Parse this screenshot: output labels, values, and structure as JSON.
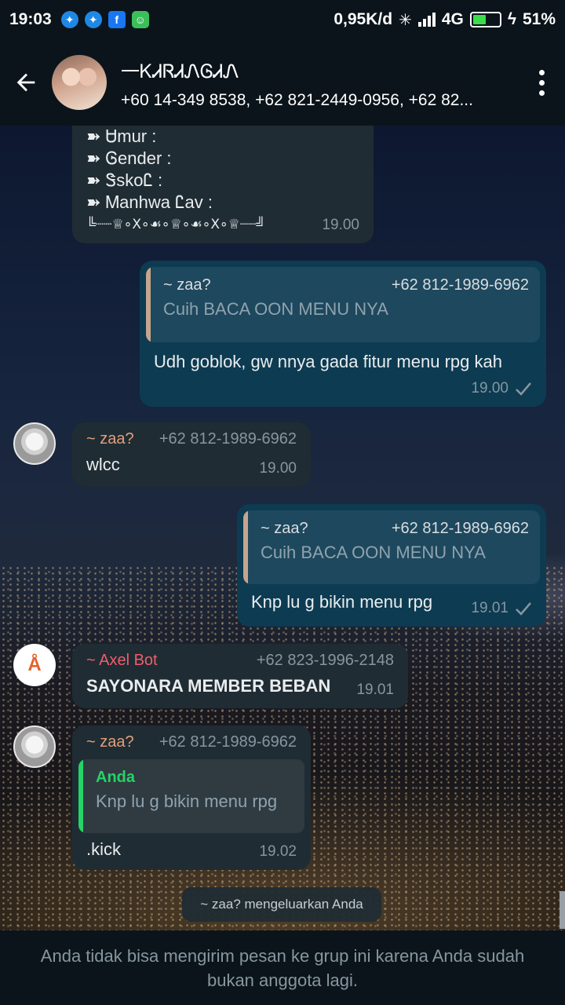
{
  "status_bar": {
    "time": "19:03",
    "net_speed": "0,95K/d",
    "network": "4G",
    "battery": "51%",
    "battery_level": 0.51,
    "notification_icons": [
      "messenger-icon",
      "messenger-icon",
      "facebook-icon",
      "android-icon"
    ]
  },
  "header": {
    "group_name": "一ᏦᏗᏒᏗᏁᎶᏗᏁ",
    "members": "+60 14-349 8538, +62 821-2449-0956, +62 82..."
  },
  "messages": {
    "m1": {
      "lines": [
        "➽ Ꮜmur :",
        "➽ Ꮆender :",
        "➽ ᏕskoᏝ :",
        "➽ Ꮇanhwa Ꮭav :",
        "╚┈┈♕∘Ⅹ∘☙∘♕∘☙∘Ⅹ∘♕┈┈╝"
      ],
      "time": "19.00"
    },
    "m2": {
      "quote_name": "~ zaa?",
      "quote_phone": "+62 812-1989-6962",
      "quote_text": "Cuih BACA OON MENU NYA",
      "text": "Udh goblok, gw nnya gada fitur menu rpg kah",
      "time": "19.00"
    },
    "m3": {
      "sender": "~ zaa?",
      "phone": "+62 812-1989-6962",
      "text": "wlcc",
      "time": "19.00"
    },
    "m4": {
      "quote_name": "~ zaa?",
      "quote_phone": "+62 812-1989-6962",
      "quote_text": "Cuih BACA OON MENU NYA",
      "text": "Knp lu g bikin menu rpg",
      "time": "19.01"
    },
    "m5": {
      "sender": "~ Axel Bot",
      "phone": "+62 823-1996-2148",
      "text": "SAYONARA MEMBER BEBAN",
      "time": "19.01"
    },
    "m6": {
      "sender": "~ zaa?",
      "phone": "+62 812-1989-6962",
      "quote_name": "Anda",
      "quote_text": "Knp lu g bikin menu rpg",
      "text": ".kick",
      "time": "19.02"
    }
  },
  "system_message": "~ zaa? mengeluarkan Anda",
  "footer_notice": "Anda tidak bisa mengirim pesan ke grup ini karena Anda sudah bukan anggota lagi.",
  "colors": {
    "header_bg": "#0b141a",
    "bubble_in": "#202c33",
    "bubble_out": "#0d3b52",
    "quote_bar_peach": "#c6a48e",
    "quote_bar_green": "#25d366",
    "sender_orange": "#e2a07a",
    "sender_red": "#f15c6d"
  }
}
